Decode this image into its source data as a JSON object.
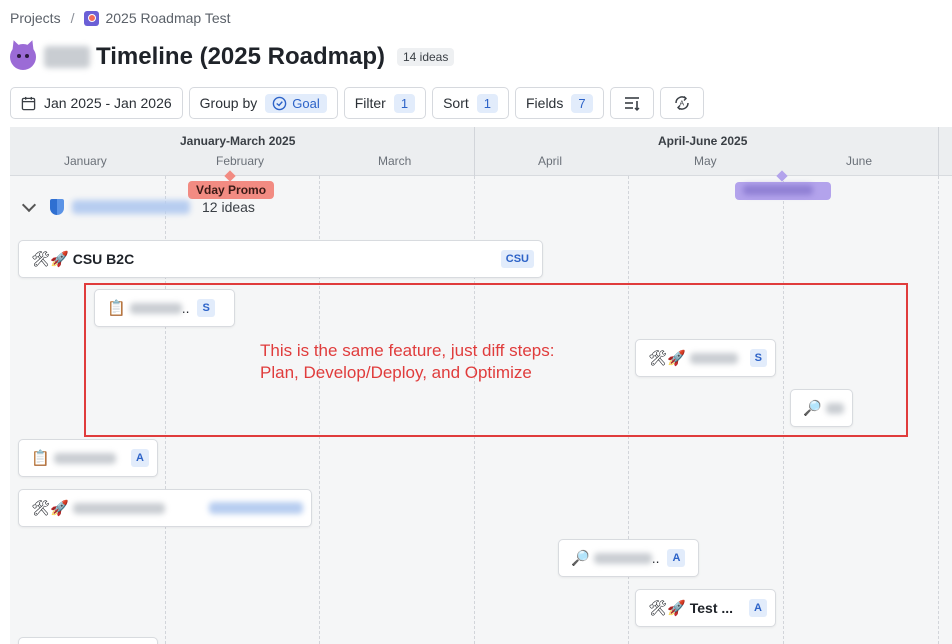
{
  "breadcrumb": {
    "root": "Projects",
    "separator": "/",
    "current": "2025 Roadmap Test"
  },
  "header": {
    "title": "Timeline (2025 Roadmap)",
    "ideas_count": "14 ideas"
  },
  "toolbar": {
    "date_range": "Jan 2025 - Jan 2026",
    "group_by_label": "Group by",
    "group_by_value": "Goal",
    "filter_label": "Filter",
    "filter_count": "1",
    "sort_label": "Sort",
    "sort_count": "1",
    "fields_label": "Fields",
    "fields_count": "7"
  },
  "timeline": {
    "quarters": [
      "January-March 2025",
      "April-June 2025"
    ],
    "months": [
      "January",
      "February",
      "March",
      "April",
      "May",
      "June"
    ],
    "milestones": [
      {
        "label": "Vday Promo",
        "color": "#f28b82"
      }
    ],
    "group": {
      "ideas_count": "12 ideas"
    },
    "cards": [
      {
        "emoji": "🛠🚀",
        "name": "CSU B2C",
        "tag": "CSU"
      },
      {
        "emoji": "📋",
        "suffix": "..",
        "tag": "S"
      },
      {
        "emoji": "🛠🚀",
        "tag": "S"
      },
      {
        "emoji": "🔎"
      },
      {
        "emoji": "📋",
        "tag": "A"
      },
      {
        "emoji": "🛠🚀"
      },
      {
        "emoji": "🔎",
        "suffix": "..",
        "tag": "A"
      },
      {
        "emoji": "🛠🚀",
        "name": "Test ...",
        "tag": "A"
      }
    ]
  },
  "annotation": {
    "line1": "This is the same feature, just diff steps:",
    "line2": "Plan, Develop/Deploy, and Optimize",
    "color": "#e03c3c"
  }
}
